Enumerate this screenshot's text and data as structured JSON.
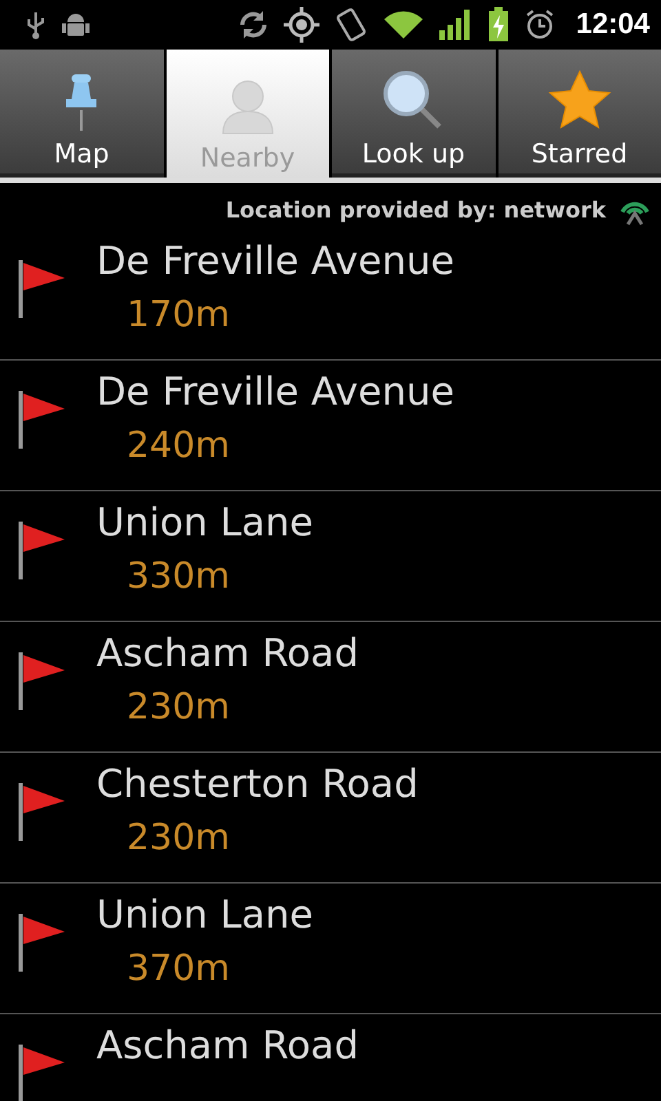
{
  "status_bar": {
    "time": "12:04"
  },
  "tabs": [
    {
      "label": "Map",
      "kind": "map",
      "selected": false
    },
    {
      "label": "Nearby",
      "kind": "nearby",
      "selected": true
    },
    {
      "label": "Look up",
      "kind": "lookup",
      "selected": false
    },
    {
      "label": "Starred",
      "kind": "starred",
      "selected": false
    }
  ],
  "location_note": "Location provided by: network",
  "places": [
    {
      "name": "De Freville Avenue",
      "distance": "170m"
    },
    {
      "name": "De Freville Avenue",
      "distance": "240m"
    },
    {
      "name": "Union Lane",
      "distance": "330m"
    },
    {
      "name": "Ascham Road",
      "distance": "230m"
    },
    {
      "name": "Chesterton Road",
      "distance": "230m"
    },
    {
      "name": "Union Lane",
      "distance": "370m"
    },
    {
      "name": "Ascham Road"
    }
  ]
}
